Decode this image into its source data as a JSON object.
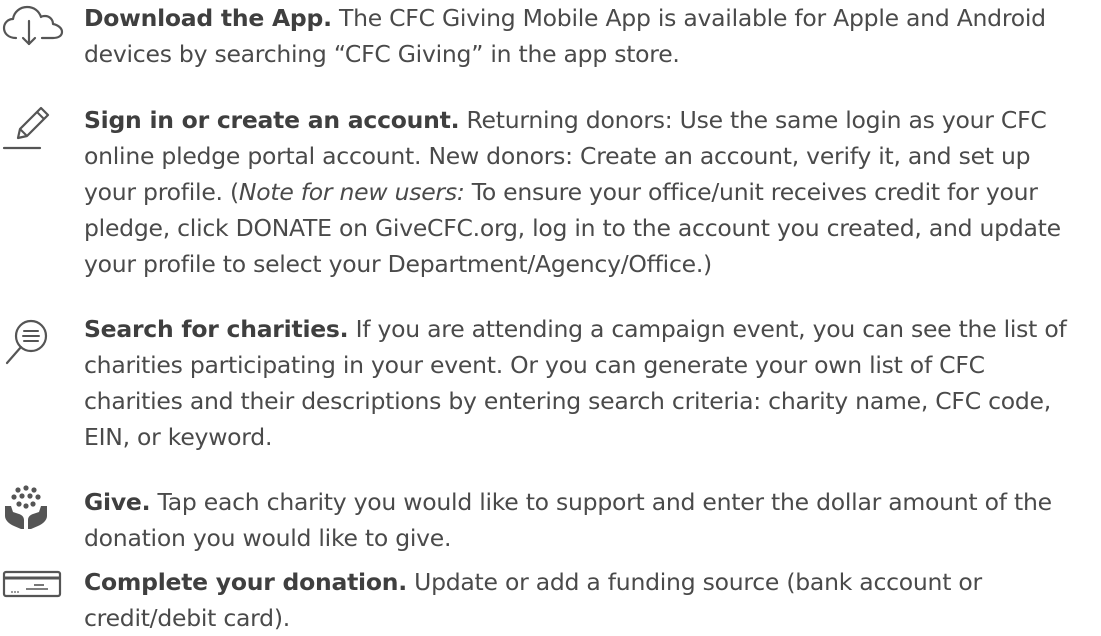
{
  "steps": [
    {
      "icon": "cloud-download-icon",
      "title": "Download the App.",
      "body": " The CFC Giving Mobile App is available for Apple and Android devices by searching “CFC Giving” in the app store."
    },
    {
      "icon": "pencil-icon",
      "title": "Sign in or create an account.",
      "body_before_note": " Returning donors: Use the same login as your CFC online pledge portal account. New donors: Create an account, verify it, and set up your profile. (",
      "note_label": "Note for new users:",
      "body_after_note": " To ensure your office/unit receives credit for your pledge, click DONATE on GiveCFC.org, log in to the account you created, and update your profile to select your Department/Agency/Office.)"
    },
    {
      "icon": "search-icon",
      "title": "Search for charities.",
      "body": " If you are attending a campaign event, you can see the list of charities participating in your event. Or you can generate your own list of CFC charities and their descriptions by entering search criteria: charity name, CFC code, EIN, or keyword."
    },
    {
      "icon": "giving-hands-icon",
      "title": "Give.",
      "body": " Tap each charity you would like to support and enter the dollar amount of the donation you would like to give."
    },
    {
      "icon": "credit-card-icon",
      "title": "Complete your donation.",
      "body": " Update or add a funding source (bank account or credit/debit card)."
    }
  ],
  "colors": {
    "text": "#4a4a4a",
    "title": "#3f3f3f",
    "icon": "#555555"
  }
}
